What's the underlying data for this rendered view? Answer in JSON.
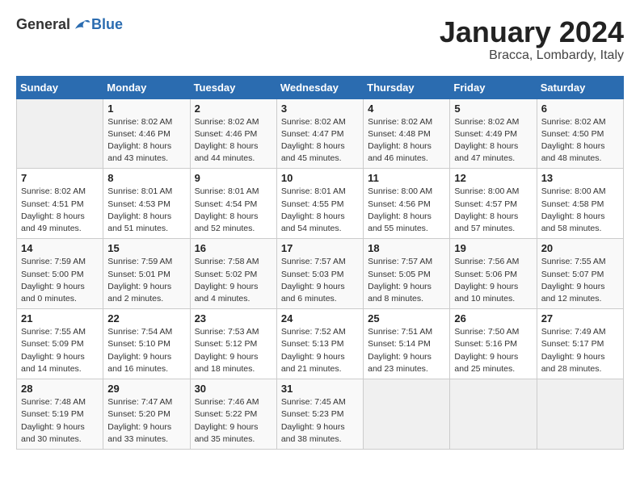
{
  "header": {
    "logo_general": "General",
    "logo_blue": "Blue",
    "month_title": "January 2024",
    "subtitle": "Bracca, Lombardy, Italy"
  },
  "days_of_week": [
    "Sunday",
    "Monday",
    "Tuesday",
    "Wednesday",
    "Thursday",
    "Friday",
    "Saturday"
  ],
  "weeks": [
    [
      {
        "day": "",
        "info": ""
      },
      {
        "day": "1",
        "info": "Sunrise: 8:02 AM\nSunset: 4:46 PM\nDaylight: 8 hours\nand 43 minutes."
      },
      {
        "day": "2",
        "info": "Sunrise: 8:02 AM\nSunset: 4:46 PM\nDaylight: 8 hours\nand 44 minutes."
      },
      {
        "day": "3",
        "info": "Sunrise: 8:02 AM\nSunset: 4:47 PM\nDaylight: 8 hours\nand 45 minutes."
      },
      {
        "day": "4",
        "info": "Sunrise: 8:02 AM\nSunset: 4:48 PM\nDaylight: 8 hours\nand 46 minutes."
      },
      {
        "day": "5",
        "info": "Sunrise: 8:02 AM\nSunset: 4:49 PM\nDaylight: 8 hours\nand 47 minutes."
      },
      {
        "day": "6",
        "info": "Sunrise: 8:02 AM\nSunset: 4:50 PM\nDaylight: 8 hours\nand 48 minutes."
      }
    ],
    [
      {
        "day": "7",
        "info": "Sunrise: 8:02 AM\nSunset: 4:51 PM\nDaylight: 8 hours\nand 49 minutes."
      },
      {
        "day": "8",
        "info": "Sunrise: 8:01 AM\nSunset: 4:53 PM\nDaylight: 8 hours\nand 51 minutes."
      },
      {
        "day": "9",
        "info": "Sunrise: 8:01 AM\nSunset: 4:54 PM\nDaylight: 8 hours\nand 52 minutes."
      },
      {
        "day": "10",
        "info": "Sunrise: 8:01 AM\nSunset: 4:55 PM\nDaylight: 8 hours\nand 54 minutes."
      },
      {
        "day": "11",
        "info": "Sunrise: 8:00 AM\nSunset: 4:56 PM\nDaylight: 8 hours\nand 55 minutes."
      },
      {
        "day": "12",
        "info": "Sunrise: 8:00 AM\nSunset: 4:57 PM\nDaylight: 8 hours\nand 57 minutes."
      },
      {
        "day": "13",
        "info": "Sunrise: 8:00 AM\nSunset: 4:58 PM\nDaylight: 8 hours\nand 58 minutes."
      }
    ],
    [
      {
        "day": "14",
        "info": "Sunrise: 7:59 AM\nSunset: 5:00 PM\nDaylight: 9 hours\nand 0 minutes."
      },
      {
        "day": "15",
        "info": "Sunrise: 7:59 AM\nSunset: 5:01 PM\nDaylight: 9 hours\nand 2 minutes."
      },
      {
        "day": "16",
        "info": "Sunrise: 7:58 AM\nSunset: 5:02 PM\nDaylight: 9 hours\nand 4 minutes."
      },
      {
        "day": "17",
        "info": "Sunrise: 7:57 AM\nSunset: 5:03 PM\nDaylight: 9 hours\nand 6 minutes."
      },
      {
        "day": "18",
        "info": "Sunrise: 7:57 AM\nSunset: 5:05 PM\nDaylight: 9 hours\nand 8 minutes."
      },
      {
        "day": "19",
        "info": "Sunrise: 7:56 AM\nSunset: 5:06 PM\nDaylight: 9 hours\nand 10 minutes."
      },
      {
        "day": "20",
        "info": "Sunrise: 7:55 AM\nSunset: 5:07 PM\nDaylight: 9 hours\nand 12 minutes."
      }
    ],
    [
      {
        "day": "21",
        "info": "Sunrise: 7:55 AM\nSunset: 5:09 PM\nDaylight: 9 hours\nand 14 minutes."
      },
      {
        "day": "22",
        "info": "Sunrise: 7:54 AM\nSunset: 5:10 PM\nDaylight: 9 hours\nand 16 minutes."
      },
      {
        "day": "23",
        "info": "Sunrise: 7:53 AM\nSunset: 5:12 PM\nDaylight: 9 hours\nand 18 minutes."
      },
      {
        "day": "24",
        "info": "Sunrise: 7:52 AM\nSunset: 5:13 PM\nDaylight: 9 hours\nand 21 minutes."
      },
      {
        "day": "25",
        "info": "Sunrise: 7:51 AM\nSunset: 5:14 PM\nDaylight: 9 hours\nand 23 minutes."
      },
      {
        "day": "26",
        "info": "Sunrise: 7:50 AM\nSunset: 5:16 PM\nDaylight: 9 hours\nand 25 minutes."
      },
      {
        "day": "27",
        "info": "Sunrise: 7:49 AM\nSunset: 5:17 PM\nDaylight: 9 hours\nand 28 minutes."
      }
    ],
    [
      {
        "day": "28",
        "info": "Sunrise: 7:48 AM\nSunset: 5:19 PM\nDaylight: 9 hours\nand 30 minutes."
      },
      {
        "day": "29",
        "info": "Sunrise: 7:47 AM\nSunset: 5:20 PM\nDaylight: 9 hours\nand 33 minutes."
      },
      {
        "day": "30",
        "info": "Sunrise: 7:46 AM\nSunset: 5:22 PM\nDaylight: 9 hours\nand 35 minutes."
      },
      {
        "day": "31",
        "info": "Sunrise: 7:45 AM\nSunset: 5:23 PM\nDaylight: 9 hours\nand 38 minutes."
      },
      {
        "day": "",
        "info": ""
      },
      {
        "day": "",
        "info": ""
      },
      {
        "day": "",
        "info": ""
      }
    ]
  ]
}
